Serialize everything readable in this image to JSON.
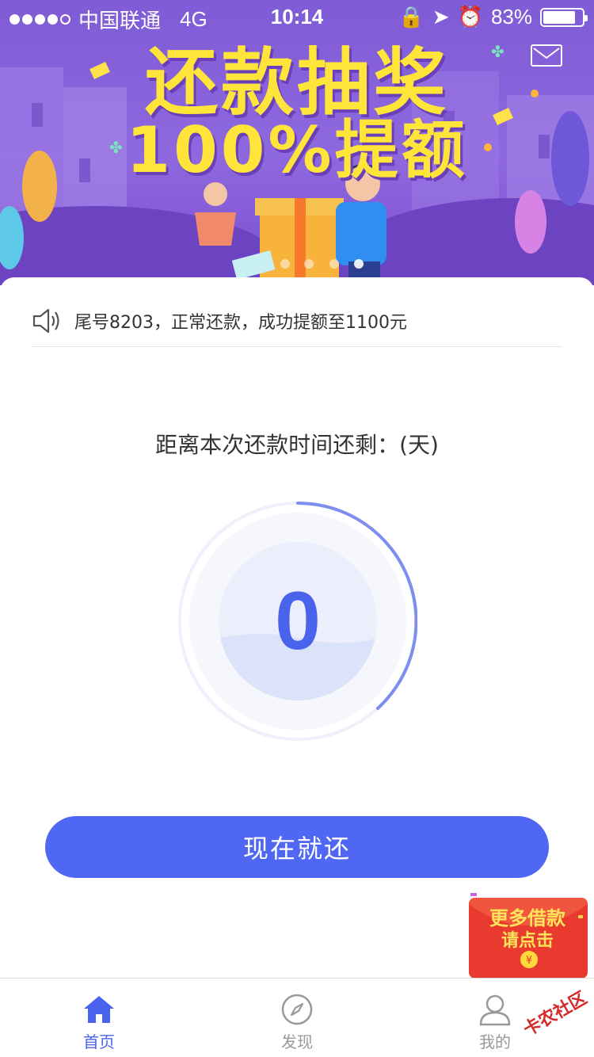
{
  "status_bar": {
    "carrier": "中国联通",
    "network": "4G",
    "time": "10:14",
    "battery": "83%",
    "battery_level": 0.83
  },
  "banner": {
    "title_line1": "还款抽奖",
    "title_line2": "100%提额"
  },
  "notice": {
    "text": "尾号8203，正常还款，成功提额至1100元"
  },
  "countdown": {
    "label": "距离本次还款时间还剩：(天)",
    "days": "0"
  },
  "repay_button": {
    "label": "现在就还"
  },
  "promo": {
    "line1": "更多借款",
    "line2": "请点击"
  },
  "tabs": [
    {
      "label": "首页",
      "icon": "home-icon",
      "active": true
    },
    {
      "label": "发现",
      "icon": "compass-icon",
      "active": false
    },
    {
      "label": "我的",
      "icon": "user-icon",
      "active": false
    }
  ],
  "watermark": "卡农社区",
  "colors": {
    "accent": "#4a63ec",
    "button": "#5067f4",
    "banner_purple": "#8e68de",
    "title_yellow": "#ffe53a"
  }
}
